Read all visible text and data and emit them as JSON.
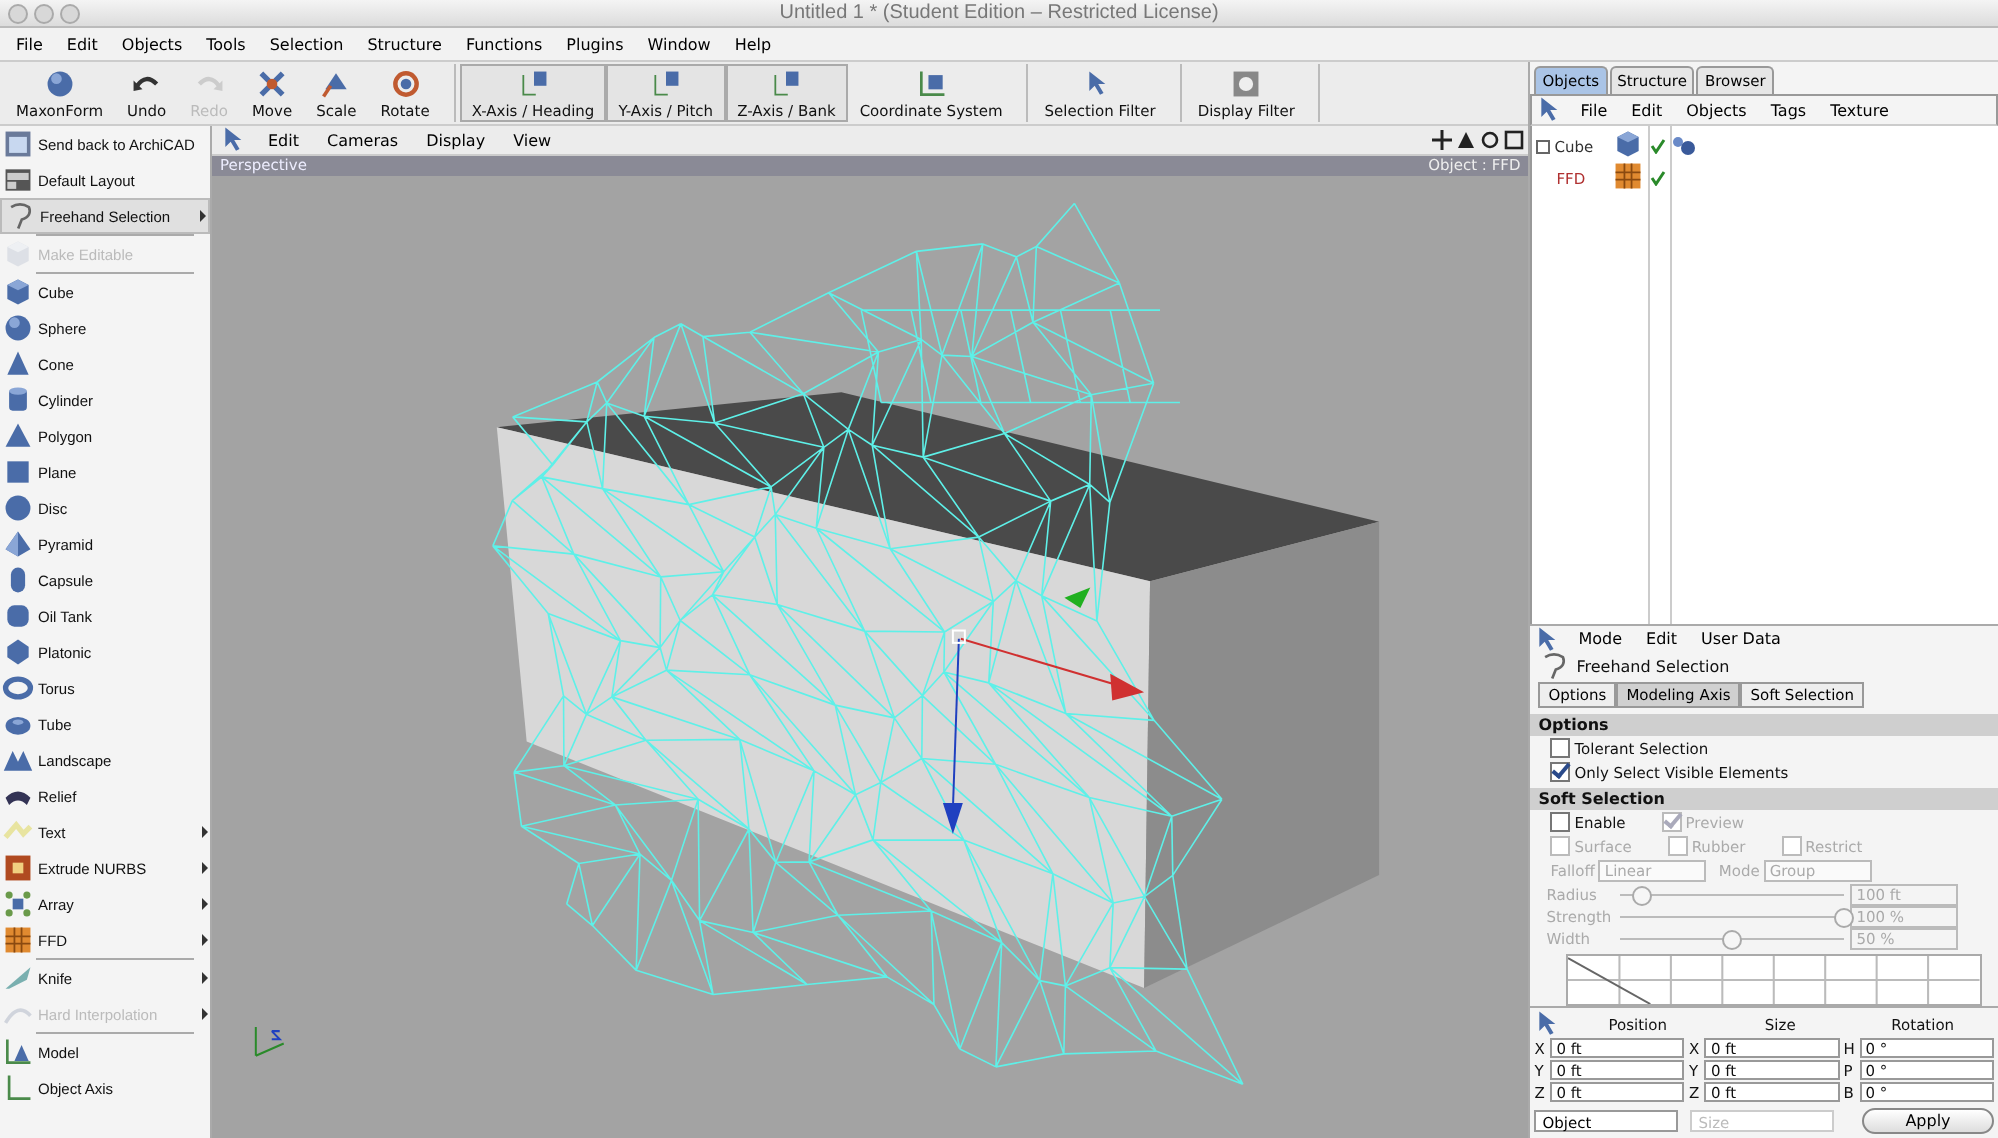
{
  "window": {
    "title": "Untitled 1 * (Student Edition – Restricted License)"
  },
  "menu": [
    "File",
    "Edit",
    "Objects",
    "Tools",
    "Selection",
    "Structure",
    "Functions",
    "Plugins",
    "Window",
    "Help"
  ],
  "toolbar": [
    [
      {
        "label": "MaxonForm",
        "disabled": false,
        "on": false
      },
      {
        "label": "Undo",
        "disabled": false,
        "on": false
      },
      {
        "label": "Redo",
        "disabled": true,
        "on": false
      },
      {
        "label": "Move",
        "disabled": false,
        "on": false
      },
      {
        "label": "Scale",
        "disabled": false,
        "on": false
      },
      {
        "label": "Rotate",
        "disabled": false,
        "on": false
      }
    ],
    [
      {
        "label": "X-Axis / Heading",
        "disabled": false,
        "on": true
      },
      {
        "label": "Y-Axis / Pitch",
        "disabled": false,
        "on": true
      },
      {
        "label": "Z-Axis / Bank",
        "disabled": false,
        "on": true
      },
      {
        "label": "Coordinate System",
        "disabled": false,
        "on": false
      }
    ],
    [
      {
        "label": "Selection Filter",
        "disabled": false,
        "on": false
      }
    ],
    [
      {
        "label": "Display Filter",
        "disabled": false,
        "on": false
      }
    ]
  ],
  "sidebar": [
    [
      {
        "label": "Send back to ArchiCAD",
        "disabled": false,
        "submenu": false,
        "selected": false
      },
      {
        "label": "Default Layout",
        "disabled": false,
        "submenu": false,
        "selected": false
      },
      {
        "label": "Freehand Selection",
        "disabled": false,
        "submenu": true,
        "selected": true
      }
    ],
    [
      {
        "label": "Make Editable",
        "disabled": true,
        "submenu": false,
        "selected": false
      }
    ],
    [
      {
        "label": "Cube",
        "disabled": false,
        "submenu": false,
        "selected": false
      },
      {
        "label": "Sphere",
        "disabled": false,
        "submenu": false,
        "selected": false
      },
      {
        "label": "Cone",
        "disabled": false,
        "submenu": false,
        "selected": false
      },
      {
        "label": "Cylinder",
        "disabled": false,
        "submenu": false,
        "selected": false
      },
      {
        "label": "Polygon",
        "disabled": false,
        "submenu": false,
        "selected": false
      },
      {
        "label": "Plane",
        "disabled": false,
        "submenu": false,
        "selected": false
      },
      {
        "label": "Disc",
        "disabled": false,
        "submenu": false,
        "selected": false
      },
      {
        "label": "Pyramid",
        "disabled": false,
        "submenu": false,
        "selected": false
      },
      {
        "label": "Capsule",
        "disabled": false,
        "submenu": false,
        "selected": false
      },
      {
        "label": "Oil Tank",
        "disabled": false,
        "submenu": false,
        "selected": false
      },
      {
        "label": "Platonic",
        "disabled": false,
        "submenu": false,
        "selected": false
      },
      {
        "label": "Torus",
        "disabled": false,
        "submenu": false,
        "selected": false
      },
      {
        "label": "Tube",
        "disabled": false,
        "submenu": false,
        "selected": false
      },
      {
        "label": "Landscape",
        "disabled": false,
        "submenu": false,
        "selected": false
      },
      {
        "label": "Relief",
        "disabled": false,
        "submenu": false,
        "selected": false
      },
      {
        "label": "Text",
        "disabled": false,
        "submenu": true,
        "selected": false
      },
      {
        "label": "Extrude NURBS",
        "disabled": false,
        "submenu": true,
        "selected": false
      },
      {
        "label": "Array",
        "disabled": false,
        "submenu": true,
        "selected": false
      },
      {
        "label": "FFD",
        "disabled": false,
        "submenu": true,
        "selected": false
      }
    ],
    [
      {
        "label": "Knife",
        "disabled": false,
        "submenu": true,
        "selected": false
      },
      {
        "label": "Hard Interpolation",
        "disabled": true,
        "submenu": true,
        "selected": false
      }
    ],
    [
      {
        "label": "Model",
        "disabled": false,
        "submenu": false,
        "selected": false
      },
      {
        "label": "Object Axis",
        "disabled": false,
        "submenu": false,
        "selected": false
      }
    ]
  ],
  "viewport": {
    "menu": [
      "Edit",
      "Cameras",
      "Display",
      "View"
    ],
    "camera": "Perspective",
    "info": "Object : FFD"
  },
  "object_manager": {
    "tabs": [
      {
        "label": "Objects",
        "selected": true
      },
      {
        "label": "Structure",
        "selected": false
      },
      {
        "label": "Browser",
        "selected": false
      }
    ],
    "menu": [
      "File",
      "Edit",
      "Objects",
      "Tags",
      "Texture"
    ],
    "objects": [
      {
        "name": "Cube",
        "color": "#303030",
        "expanded": true,
        "enabled": true,
        "tagged": true,
        "children": [
          {
            "name": "FFD",
            "color": "#b03030",
            "enabled": true
          }
        ]
      }
    ]
  },
  "attributes": {
    "menu": [
      "Mode",
      "Edit",
      "User Data"
    ],
    "title": "Freehand Selection",
    "tabs": [
      {
        "label": "Options",
        "selected": false
      },
      {
        "label": "Modeling Axis",
        "selected": true
      },
      {
        "label": "Soft Selection",
        "selected": false
      }
    ],
    "options_title": "Options",
    "options": [
      {
        "label": "Tolerant Selection",
        "checked": false
      },
      {
        "label": "Only Select Visible Elements",
        "checked": true
      }
    ],
    "soft_title": "Soft Selection",
    "soft_checks": [
      {
        "label": "Enable",
        "checked": false,
        "disabled": false
      },
      {
        "label": "Preview",
        "checked": true,
        "disabled": true
      },
      {
        "label": "Surface",
        "checked": false,
        "disabled": true
      },
      {
        "label": "Rubber",
        "checked": false,
        "disabled": true
      },
      {
        "label": "Restrict",
        "checked": false,
        "disabled": true
      }
    ],
    "dropdowns": [
      {
        "label": "Falloff",
        "value": "Linear"
      },
      {
        "label": "Mode",
        "value": "Group"
      }
    ],
    "sliders": [
      {
        "label": "Radius",
        "level": 0.1,
        "reading": "100 ft"
      },
      {
        "label": "Strength",
        "level": 1.0,
        "reading": "100 %"
      },
      {
        "label": "Width",
        "level": 0.5,
        "reading": "50 %"
      }
    ]
  },
  "coordinates": {
    "headers": [
      "Position",
      "Size",
      "Rotation"
    ],
    "columns": [
      [
        {
          "axis": "X",
          "value": "0 ft"
        },
        {
          "axis": "Y",
          "value": "0 ft"
        },
        {
          "axis": "Z",
          "value": "0 ft"
        }
      ],
      [
        {
          "axis": "X",
          "value": "0 ft"
        },
        {
          "axis": "Y",
          "value": "0 ft"
        },
        {
          "axis": "Z",
          "value": "0 ft"
        }
      ],
      [
        {
          "axis": "H",
          "value": "0 °"
        },
        {
          "axis": "P",
          "value": "0 °"
        },
        {
          "axis": "B",
          "value": "0 °"
        }
      ]
    ],
    "mode": {
      "value": "Object",
      "disabled": false
    },
    "size_mode": {
      "value": "Size",
      "disabled": true
    },
    "apply": "Apply"
  }
}
